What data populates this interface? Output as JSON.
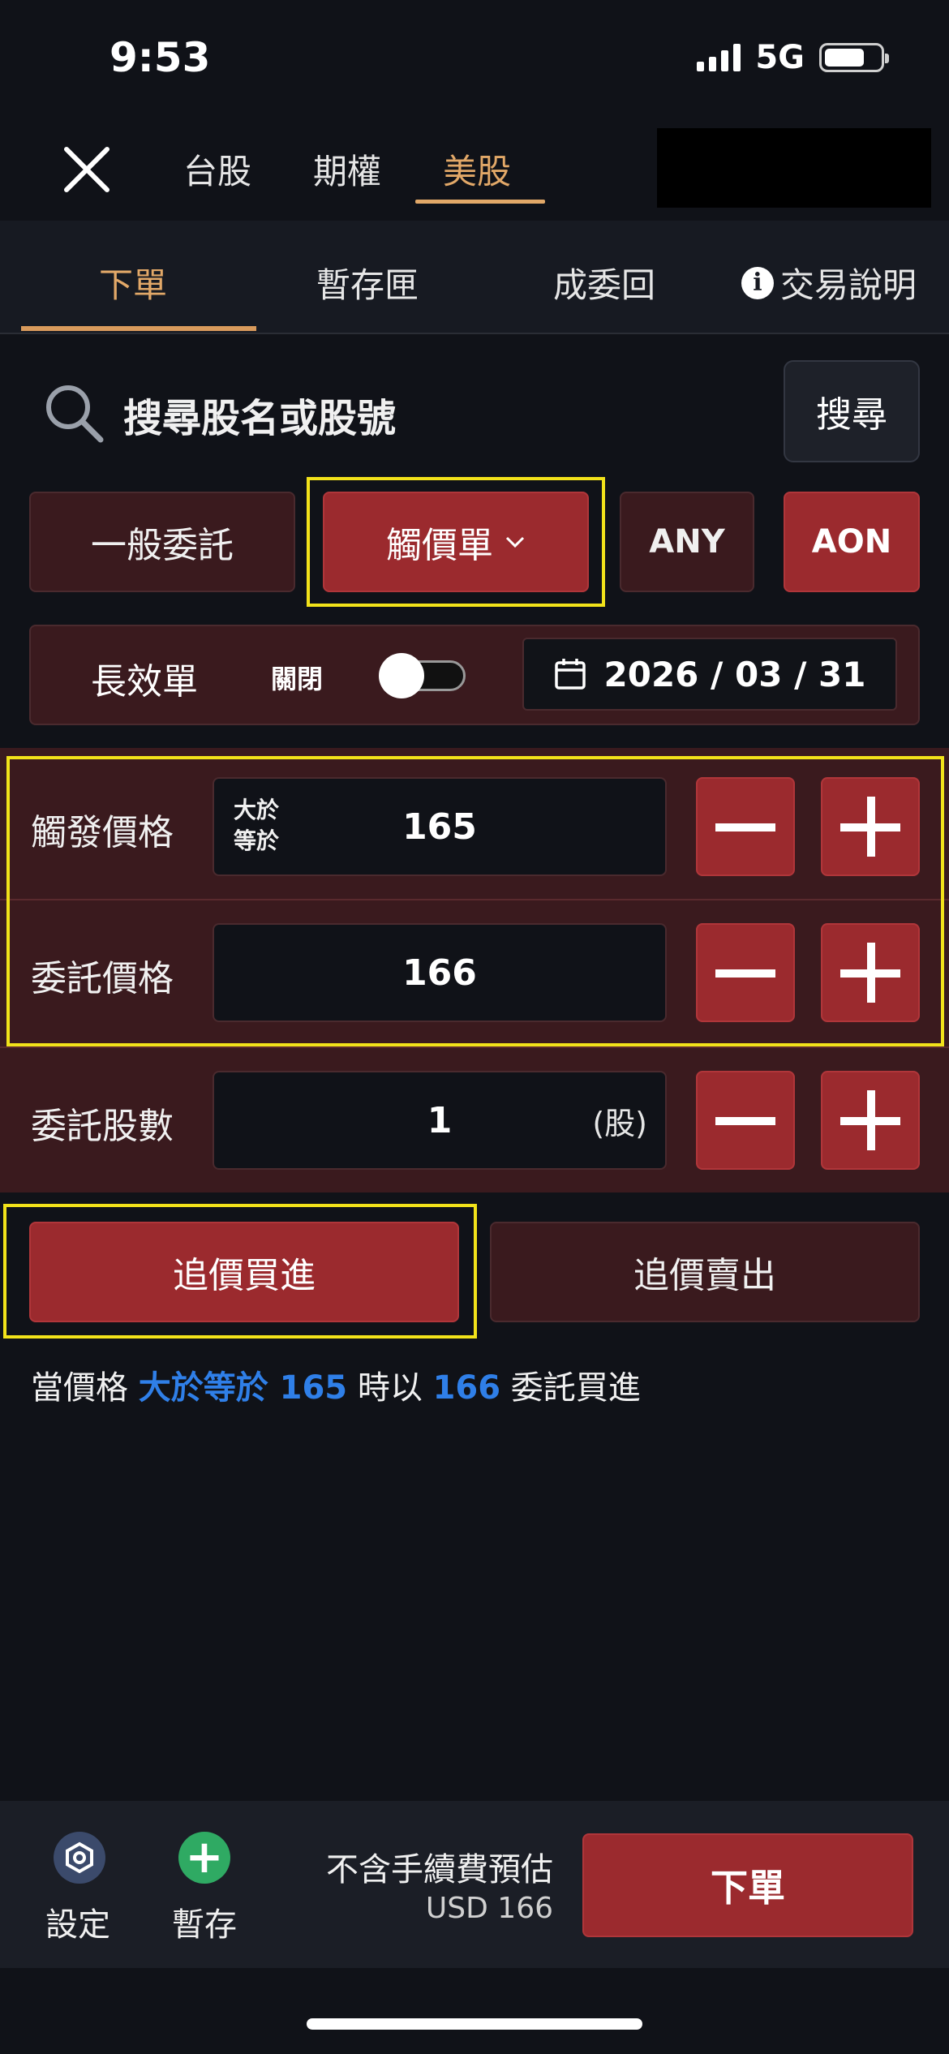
{
  "status_bar": {
    "time": "9:53",
    "network": "5G"
  },
  "market_tabs": [
    {
      "label": "台股",
      "active": false
    },
    {
      "label": "期權",
      "active": false
    },
    {
      "label": "美股",
      "active": true
    }
  ],
  "sub_tabs": {
    "order": "下單",
    "draft": "暫存匣",
    "filled": "成委回",
    "help": "交易說明"
  },
  "search": {
    "placeholder": "搜尋股名或股號",
    "button": "搜尋"
  },
  "order_types": {
    "general": "一般委託",
    "trigger": "觸價單",
    "any": "ANY",
    "aon": "AON"
  },
  "long_order": {
    "label": "長效單",
    "toggle_label": "關閉",
    "toggle_on": false,
    "date": "2026 / 03 / 31"
  },
  "trigger_price": {
    "label": "觸發價格",
    "condition_line1": "大於",
    "condition_line2": "等於",
    "value": "165"
  },
  "order_price": {
    "label": "委託價格",
    "value": "166"
  },
  "quantity": {
    "label": "委託股數",
    "value": "1",
    "unit": "(股)"
  },
  "actions": {
    "buy": "追價買進",
    "sell": "追價賣出"
  },
  "hint": {
    "prefix": "當價格 ",
    "condition": "大於等於 165",
    "middle": " 時以 ",
    "price": "166",
    "suffix": " 委託買進"
  },
  "bottom": {
    "settings": "設定",
    "save": "暫存",
    "estimate_label": "不含手續費預估",
    "estimate_value": "USD 166",
    "submit": "下單"
  },
  "colors": {
    "accent": "#e2a868",
    "panel_red": "#3a1a1e",
    "button_red": "#9b2a2e",
    "highlight_blue": "#2f7fe8",
    "annotation_yellow": "#f2e21a"
  }
}
